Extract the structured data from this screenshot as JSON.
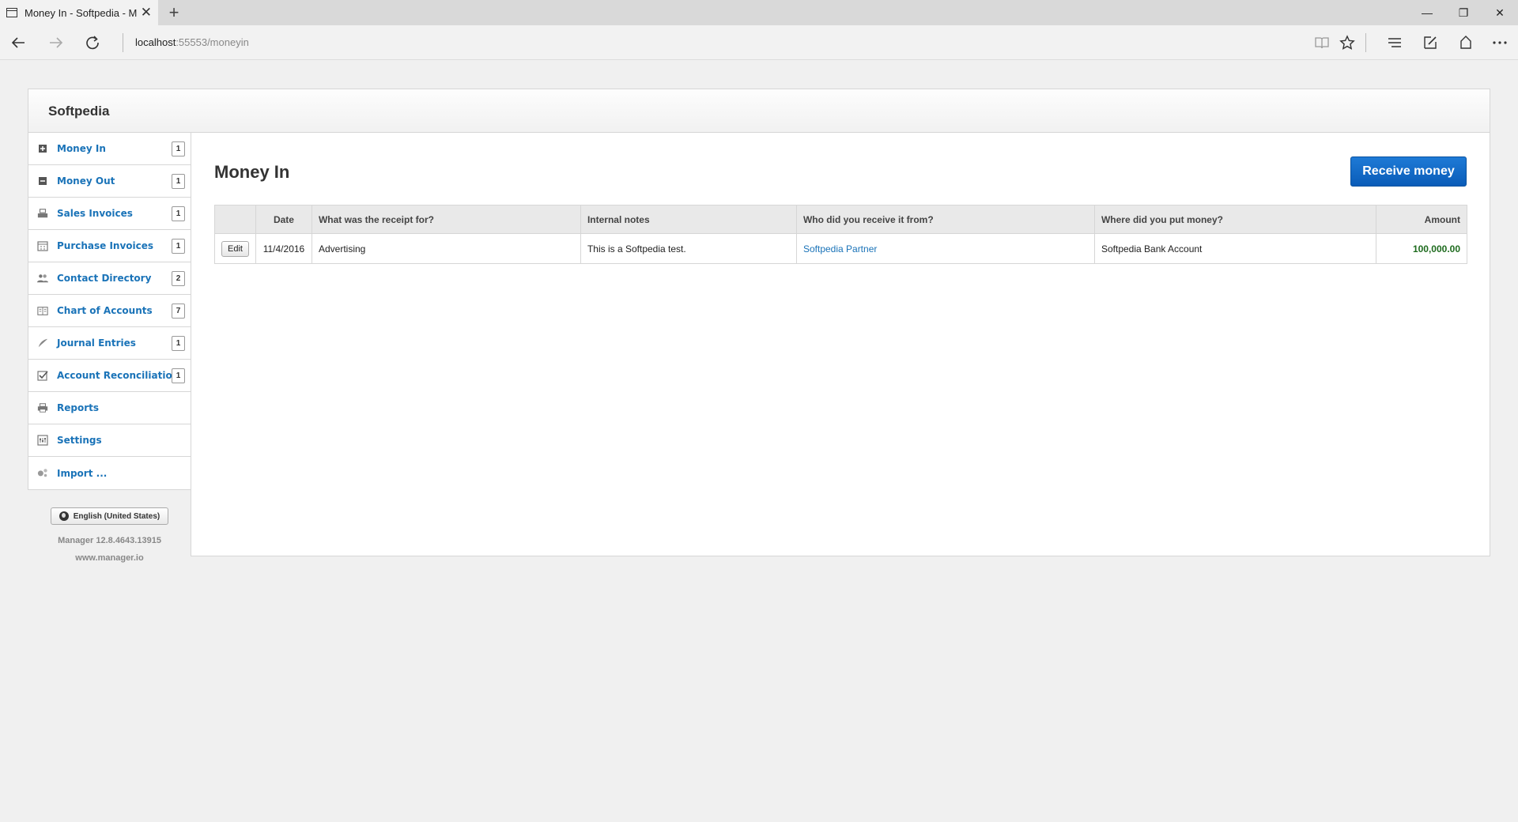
{
  "browser": {
    "tab_title": "Money In - Softpedia - M",
    "close_glyph": "✕",
    "new_tab_glyph": "+",
    "window_controls": {
      "minimize": "—",
      "restore": "❐",
      "close": "✕"
    },
    "address": {
      "host": "localhost",
      "rest": ":55553/moneyin"
    }
  },
  "app": {
    "title": "Softpedia"
  },
  "sidebar": {
    "items": [
      {
        "label": "Money In",
        "badge": "1",
        "icon": "plus-square-icon"
      },
      {
        "label": "Money Out",
        "badge": "1",
        "icon": "minus-square-icon"
      },
      {
        "label": "Sales Invoices",
        "badge": "1",
        "icon": "cash-register-icon"
      },
      {
        "label": "Purchase Invoices",
        "badge": "1",
        "icon": "calendar-icon"
      },
      {
        "label": "Contact Directory",
        "badge": "2",
        "icon": "users-icon"
      },
      {
        "label": "Chart of Accounts",
        "badge": "7",
        "icon": "book-icon"
      },
      {
        "label": "Journal Entries",
        "badge": "1",
        "icon": "quill-icon"
      },
      {
        "label": "Account Reconciliation",
        "badge": "1",
        "icon": "checkbox-icon"
      },
      {
        "label": "Reports",
        "badge": "",
        "icon": "printer-icon"
      },
      {
        "label": "Settings",
        "badge": "",
        "icon": "settings-icon"
      },
      {
        "label": "Import ...",
        "badge": "",
        "icon": "import-icon"
      }
    ],
    "language": "English (United States)",
    "version": "Manager 12.8.4643.13915",
    "site": "www.manager.io"
  },
  "main": {
    "title": "Money In",
    "receive_button": "Receive money",
    "table": {
      "headers": {
        "edit": "",
        "date": "Date",
        "receipt_for": "What was the receipt for?",
        "notes": "Internal notes",
        "from": "Who did you receive it from?",
        "put": "Where did you put money?",
        "amount": "Amount"
      },
      "rows": [
        {
          "edit": "Edit",
          "date": "11/4/2016",
          "receipt_for": "Advertising",
          "notes": "This is a Softpedia test.",
          "from": "Softpedia Partner",
          "put": "Softpedia Bank Account",
          "amount": "100,000.00"
        }
      ]
    }
  },
  "colors": {
    "link": "#1a73b8",
    "primary_button": "#0a5cb8",
    "amount": "#1e6b1e"
  }
}
